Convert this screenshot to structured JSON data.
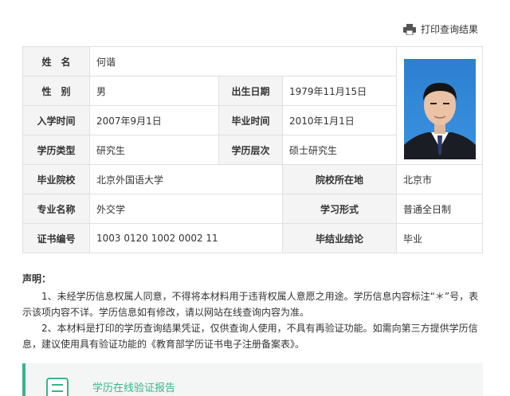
{
  "toolbar": {
    "print_label": "打印查询结果"
  },
  "labels": {
    "name": "姓　名",
    "gender": "性　别",
    "birth_date": "出生日期",
    "enroll_date": "入学时间",
    "grad_date": "毕业时间",
    "edu_type": "学历类型",
    "edu_level": "学历层次",
    "school": "毕业院校",
    "school_location": "院校所在地",
    "major": "专业名称",
    "study_mode": "学习形式",
    "cert_no": "证书编号",
    "conclusion": "毕结业结论"
  },
  "values": {
    "name": "何谐",
    "gender": "男",
    "birth_date": "1979年11月15日",
    "enroll_date": "2007年9月1日",
    "grad_date": "2010年1月1日",
    "edu_type": "研究生",
    "edu_level": "硕士研究生",
    "school": "北京外国语大学",
    "school_location": "北京市",
    "major": "外交学",
    "study_mode": "普通全日制",
    "cert_no": "1003 0120 1002 0002 11",
    "conclusion": "毕业"
  },
  "declaration": {
    "title": "声明：",
    "p1": "1、未经学历信息权属人同意，不得将本材料用于违背权属人意愿之用途。学历信息内容标注“＊”号，表示该项内容不详。学历信息如有修改，请以网站在线查询内容为准。",
    "p2": "2、本材料是打印的学历查询结果凭证，仅供查询人使用，不具有再验证功能。如需向第三方提供学历信息，建议使用具有验证功能的《教育部学历证书电子注册备案表》。"
  },
  "verify": {
    "label": "学历在线验证报告"
  },
  "colors": {
    "accent": "#38b48b",
    "label_bg": "#f4f4f4",
    "border": "#e0e0e0"
  }
}
